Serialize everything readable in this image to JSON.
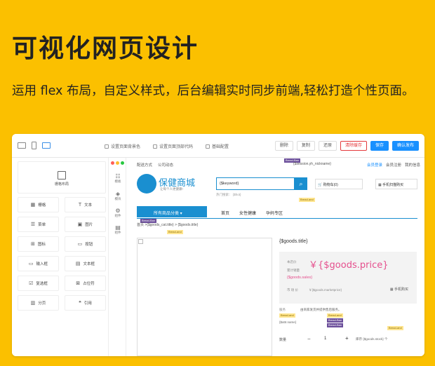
{
  "hero": {
    "title": "可视化网页设计",
    "desc": "运用 flex 布局，自定义样式，后台编辑实时同步前端,轻松打造个性页面。"
  },
  "toolbar": {
    "opt1": "设置页面背景色",
    "opt2": "设置页面顶部代码",
    "opt3": "基础配置",
    "buttons": [
      "删除",
      "复制",
      "还原",
      "清除缓存",
      "保存",
      "确认发布"
    ]
  },
  "components": {
    "layout": "栅格布局",
    "items": [
      {
        "icon": "▦",
        "label": "栅格",
        "name": "grid"
      },
      {
        "icon": "T",
        "label": "文本",
        "name": "text"
      },
      {
        "icon": "☰",
        "label": "菜单",
        "name": "menu"
      },
      {
        "icon": "▣",
        "label": "图片",
        "name": "image"
      },
      {
        "icon": "⊞",
        "label": "图标",
        "name": "icon"
      },
      {
        "icon": "▭",
        "label": "按钮",
        "name": "button"
      },
      {
        "icon": "▭",
        "label": "输入框",
        "name": "input"
      },
      {
        "icon": "▤",
        "label": "文本框",
        "name": "textarea"
      },
      {
        "icon": "☑",
        "label": "复选框",
        "name": "checkbox"
      },
      {
        "icon": "⊠",
        "label": "占位符",
        "name": "placeholder"
      },
      {
        "icon": "▥",
        "label": "分页",
        "name": "pagination"
      },
      {
        "icon": "❝",
        "label": "引用",
        "name": "quote"
      }
    ]
  },
  "side": {
    "items": [
      {
        "icon": "☷",
        "label": "模板"
      },
      {
        "icon": "◈",
        "label": "模块"
      },
      {
        "icon": "⚙",
        "label": "组件"
      },
      {
        "icon": "▤",
        "label": "组件"
      }
    ]
  },
  "canvas": {
    "top_nav": [
      "配送方式",
      "公司动态"
    ],
    "session": "{$session.yh_nickname}",
    "top_right": [
      "会员登录",
      "会员注册",
      "我的信息"
    ],
    "logo_text": "保健商城",
    "logo_sub": "让每个人更健康!",
    "search": "{$keyword}",
    "search_hint": "热门搜索：  {$hot}",
    "cart": "购物车(0)",
    "qrcode": "手机扫描购买",
    "cat_all": "所有商品分类",
    "cat_links": [
      "首页",
      "女性健康",
      "孕妈专区"
    ],
    "crumb": "首页  >{$goods_cat.title} > {$goods.title}",
    "goods_title": "{$goods.title}",
    "price_label": "本店价",
    "price": "￥{$goods.price}",
    "sales_label": "累计销量",
    "sales": "{$goods.sales}",
    "market_label": "市 场 价",
    "market": "￥{$goods.marketprice}",
    "mobile": "手机购买",
    "service_label": "服务",
    "service": "由商家发货并提供售后服务。",
    "attr": "{$attr.name}",
    "qty_label": "数量",
    "qty": "1",
    "stock": "库存 {$goods.stock} 个",
    "tag_dark": "Bread-Ban",
    "tag_yellow": "Bread-and"
  }
}
